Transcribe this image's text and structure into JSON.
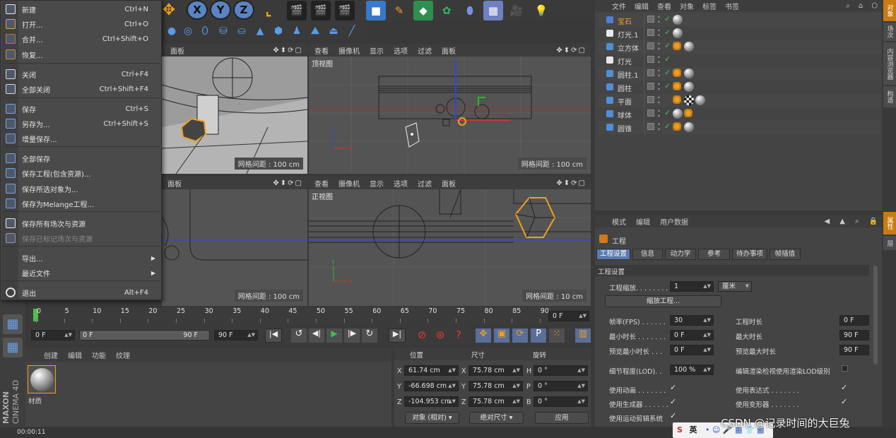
{
  "file_menu": {
    "items": [
      {
        "label": "新建",
        "shortcut": "Ctrl+N"
      },
      {
        "label": "打开...",
        "shortcut": "Ctrl+O"
      },
      {
        "label": "合并...",
        "shortcut": "Ctrl+Shift+O"
      },
      {
        "label": "恢复...",
        "shortcut": ""
      },
      {
        "label": "关闭",
        "shortcut": "Ctrl+F4"
      },
      {
        "label": "全部关闭",
        "shortcut": "Ctrl+Shift+F4"
      },
      {
        "label": "保存",
        "shortcut": "Ctrl+S"
      },
      {
        "label": "另存为...",
        "shortcut": "Ctrl+Shift+S"
      },
      {
        "label": "增量保存...",
        "shortcut": ""
      },
      {
        "label": "全部保存",
        "shortcut": ""
      },
      {
        "label": "保存工程(包含资源)...",
        "shortcut": ""
      },
      {
        "label": "保存所选对象为...",
        "shortcut": ""
      },
      {
        "label": "保存为Melange工程...",
        "shortcut": ""
      },
      {
        "label": "保存所有场次与资源",
        "shortcut": ""
      },
      {
        "label": "保存已标记场次与资源",
        "shortcut": ""
      },
      {
        "label": "导出...",
        "shortcut": ""
      },
      {
        "label": "最近文件",
        "shortcut": ""
      },
      {
        "label": "退出",
        "shortcut": "Alt+F4"
      }
    ]
  },
  "toolbar": {
    "axis_x": "X",
    "axis_y": "Y",
    "axis_z": "Z"
  },
  "viewports": {
    "menu": [
      "查看",
      "摄像机",
      "显示",
      "选项",
      "过滤",
      "面板"
    ],
    "tl_menu_tail": "面板",
    "bl_menu_tail": "面板",
    "top_name": "顶视图",
    "front_name": "正视图",
    "grid_tl": "网格间距 : 100 cm",
    "grid_tr": "网格间距 : 100 cm",
    "grid_bl": "网格间距 : 100 cm",
    "grid_br": "网格间距 : 10 cm"
  },
  "objects_panel": {
    "menu": [
      "文件",
      "编辑",
      "查看",
      "对象",
      "标签",
      "书签"
    ],
    "rows": [
      {
        "name": "宝石",
        "color": "#4f7fd1",
        "selected": true
      },
      {
        "name": "灯光.1",
        "color": "#e8e8e8"
      },
      {
        "name": "立方体",
        "color": "#4f8fd8"
      },
      {
        "name": "灯光",
        "color": "#e8e8e8"
      },
      {
        "name": "圆柱.1",
        "color": "#4f8fd8"
      },
      {
        "name": "圆柱",
        "color": "#4f8fd8"
      },
      {
        "name": "平面",
        "color": "#4f8fd8"
      },
      {
        "name": "球体",
        "color": "#4f8fd8"
      },
      {
        "name": "圆锥",
        "color": "#4f8fd8"
      }
    ]
  },
  "side_tabs": {
    "objects": "对象",
    "scenes": "场次",
    "content": "内容浏览器",
    "structure": "构造",
    "attributes": "属性",
    "layers": "层"
  },
  "timeline": {
    "ticks": [
      "0",
      "5",
      "10",
      "15",
      "20",
      "25",
      "30",
      "35",
      "40",
      "45",
      "50",
      "55",
      "60",
      "65",
      "70",
      "75",
      "80",
      "85",
      "90"
    ],
    "end_field": "0 F",
    "start_field": "0 F",
    "range_start": "0 F",
    "range_end": "90 F",
    "max_field": "90 F"
  },
  "materials": {
    "menu": [
      "创建",
      "编辑",
      "功能",
      "纹理"
    ],
    "material_name": "材质"
  },
  "coordinates": {
    "headers": [
      "位置",
      "尺寸",
      "旋转"
    ],
    "pos": {
      "x": "61.74 cm",
      "y": "-66.698 cm",
      "z": "-104.953 cm"
    },
    "size": {
      "x": "75.78 cm",
      "y": "75.78 cm",
      "z": "75.78 cm"
    },
    "rot": {
      "h": "0 °",
      "p": "0 °",
      "b": "0 °"
    },
    "mode_select": "对象 (相对)",
    "size_select": "绝对尺寸",
    "apply": "应用"
  },
  "attributes": {
    "menu": [
      "模式",
      "编辑",
      "用户数据"
    ],
    "title": "工程",
    "tabs": [
      "工程设置",
      "信息",
      "动力学",
      "参考",
      "待办事项",
      "帧插值"
    ],
    "section": "工程设置",
    "scale_label": "工程缩放. . . . . . . .",
    "scale_value": "1",
    "scale_unit": "厘米",
    "scale_button": "缩放工程...",
    "fps_label": "帧率(FPS) . . . . . .",
    "fps_value": "30",
    "project_time_label": "工程时长",
    "project_time_value": "0 F",
    "min_label": "最小时长 . . . . . . .",
    "min_value": "0 F",
    "max_label": "最大时长",
    "max_value": "90 F",
    "pmin_label": "预览最小时长 . . .",
    "pmin_value": "0 F",
    "pmax_label": "预览最大时长",
    "pmax_value": "90 F",
    "lod_label": "细节程度(LOD). .",
    "lod_value": "100 %",
    "lod_render_label": "编辑渲染检视使用渲染LOD级别",
    "anim_label": "使用动画 . . . . . . .",
    "expr_label": "使用表达式 . . . . . . .",
    "gen_label": "使用生成器 . . . . . .",
    "deform_label": "使用变形器 . . . . . . .",
    "motion_label": "使用运动剪辑系统"
  },
  "status": {
    "time": "00:00:11",
    "watermark": "CSDN @记录时间的大巨兔",
    "ime": "英"
  },
  "logo": {
    "brand": "MAXON",
    "product": "CINEMA 4D"
  }
}
